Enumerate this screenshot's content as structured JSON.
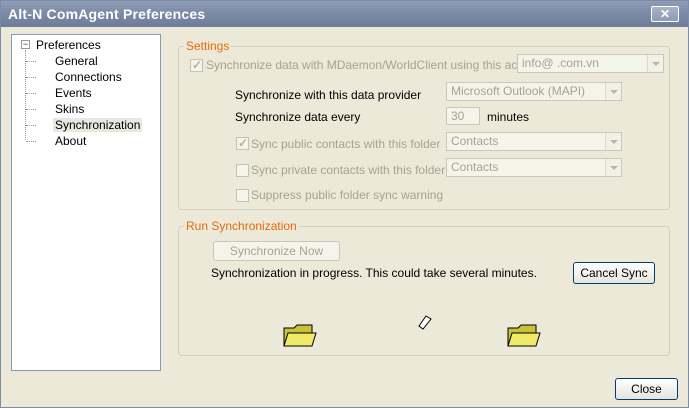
{
  "window": {
    "title": "Alt-N ComAgent Preferences",
    "close_glyph": "✕"
  },
  "tree": {
    "expander": "−",
    "root": "Preferences",
    "items": [
      {
        "label": "General"
      },
      {
        "label": "Connections"
      },
      {
        "label": "Events"
      },
      {
        "label": "Skins"
      },
      {
        "label": "Synchronization",
        "selected": true
      },
      {
        "label": "About"
      }
    ]
  },
  "settings": {
    "title": "Settings",
    "sync_account_label": "Synchronize data with MDaemon/WorldClient using this account",
    "sync_account_checked": true,
    "account_value": "info@     .com.vn",
    "provider_label": "Synchronize with this data provider",
    "provider_value": "Microsoft Outlook (MAPI)",
    "interval_label": "Synchronize data every",
    "interval_value": "30",
    "interval_unit": "minutes",
    "public_contacts_label": "Sync public contacts with this folder",
    "public_contacts_checked": true,
    "public_contacts_value": "Contacts",
    "private_contacts_label": "Sync private contacts with this folder",
    "private_contacts_checked": false,
    "private_contacts_value": "Contacts",
    "suppress_label": "Suppress public folder sync warning",
    "suppress_checked": false
  },
  "run": {
    "title": "Run Synchronization",
    "sync_now_label": "Synchronize Now",
    "status_text": "Synchronization in progress.  This could take several minutes.",
    "cancel_label": "Cancel Sync"
  },
  "footer": {
    "close_label": "Close"
  },
  "colors": {
    "group_title": "#e46a10",
    "title_bar": "#7c8ba6",
    "window_bg": "#ece9d8"
  }
}
